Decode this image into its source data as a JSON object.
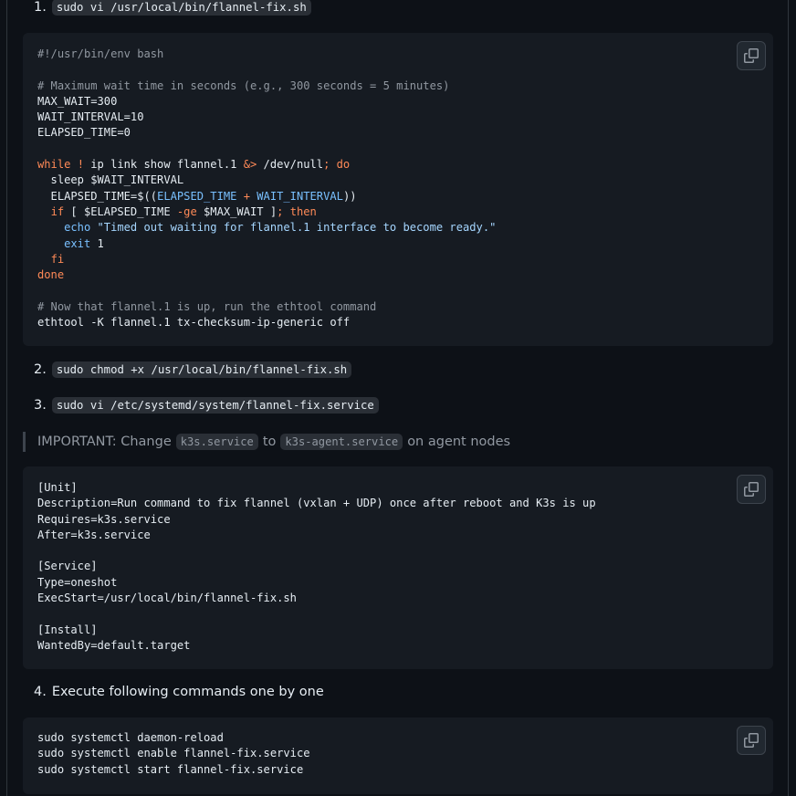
{
  "steps": [
    {
      "num": "1.",
      "code": "sudo vi /usr/local/bin/flannel-fix.sh"
    },
    {
      "num": "2.",
      "code": "sudo chmod +x /usr/local/bin/flannel-fix.sh"
    },
    {
      "num": "3.",
      "code": "sudo vi /etc/systemd/system/flannel-fix.service"
    },
    {
      "num": "4.",
      "text": "Execute following commands one by one"
    }
  ],
  "script_block": {
    "lines": [
      "#!/usr/bin/env bash",
      "",
      "# Maximum wait time in seconds (e.g., 300 seconds = 5 minutes)",
      "MAX_WAIT=300",
      "WAIT_INTERVAL=10",
      "ELAPSED_TIME=0",
      "",
      "while ! ip link show flannel.1 &> /dev/null; do",
      "  sleep $WAIT_INTERVAL",
      "  ELAPSED_TIME=$((ELAPSED_TIME + WAIT_INTERVAL))",
      "  if [ $ELAPSED_TIME -ge $MAX_WAIT ]; then",
      "    echo \"Timed out waiting for flannel.1 interface to become ready.\"",
      "    exit 1",
      "  fi",
      "done",
      "",
      "# Now that flannel.1 is up, run the ethtool command",
      "ethtool -K flannel.1 tx-checksum-ip-generic off"
    ]
  },
  "note": {
    "prefix": "IMPORTANT: Change",
    "code1": "k3s.service",
    "middle": "to",
    "code2": "k3s-agent.service",
    "suffix": "on agent nodes"
  },
  "service_block": {
    "lines": [
      "[Unit]",
      "Description=Run command to fix flannel (vxlan + UDP) once after reboot and K3s is up",
      "Requires=k3s.service",
      "After=k3s.service",
      "",
      "[Service]",
      "Type=oneshot",
      "ExecStart=/usr/local/bin/flannel-fix.sh",
      "",
      "[Install]",
      "WantedBy=default.target"
    ]
  },
  "commands_block": {
    "lines": [
      "sudo systemctl daemon-reload",
      "sudo systemctl enable flannel-fix.service",
      "sudo systemctl start flannel-fix.service"
    ]
  },
  "icons": {
    "copy": "copy-icon"
  },
  "colors": {
    "background": "#0d1117",
    "code_bg": "#161b22",
    "keyword": "#ff8a57",
    "string": "#a5d6ff",
    "variable": "#79c0ff",
    "comment": "#9198a1"
  }
}
